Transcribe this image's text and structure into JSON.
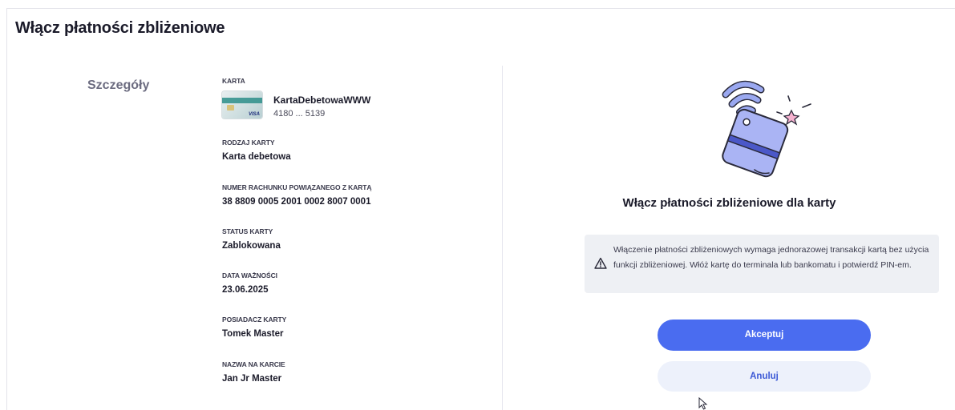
{
  "page": {
    "title": "Włącz płatności zbliżeniowe"
  },
  "section": {
    "label": "Szczegóły"
  },
  "card": {
    "label": "KARTA",
    "name": "KartaDebetowaWWW",
    "number": "4180 ... 5139",
    "thumb_brand": "VISA"
  },
  "fields": {
    "card_type": {
      "label": "RODZAJ KARTY",
      "value": "Karta debetowa"
    },
    "linked_account": {
      "label": "NUMER RACHUNKU POWIĄZANEGO Z KARTĄ",
      "value": "38 8809 0005 2001 0002 8007 0001"
    },
    "status": {
      "label": "STATUS KARTY",
      "value": "Zablokowana"
    },
    "expiry": {
      "label": "DATA WAŻNOŚCI",
      "value": "23.06.2025"
    },
    "holder": {
      "label": "POSIADACZ KARTY",
      "value": "Tomek Master"
    },
    "name_on_card": {
      "label": "NAZWA NA KARCIE",
      "value": "Jan Jr Master"
    }
  },
  "promo": {
    "title": "Włącz płatności zbliżeniowe dla karty"
  },
  "notice": {
    "icon": "warning-icon",
    "text": "Włączenie płatności zbliżeniowych wymaga jednorazowej transakcji kartą bez użycia funkcji zbliżeniowej. Włóż kartę do terminala lub bankomatu i potwierdź PIN-em."
  },
  "actions": {
    "accept_label": "Akceptuj",
    "cancel_label": "Anuluj"
  },
  "colors": {
    "primary": "#4a6cf0",
    "secondary_bg": "#edf1fb",
    "illustration": "#9aa8f0"
  }
}
